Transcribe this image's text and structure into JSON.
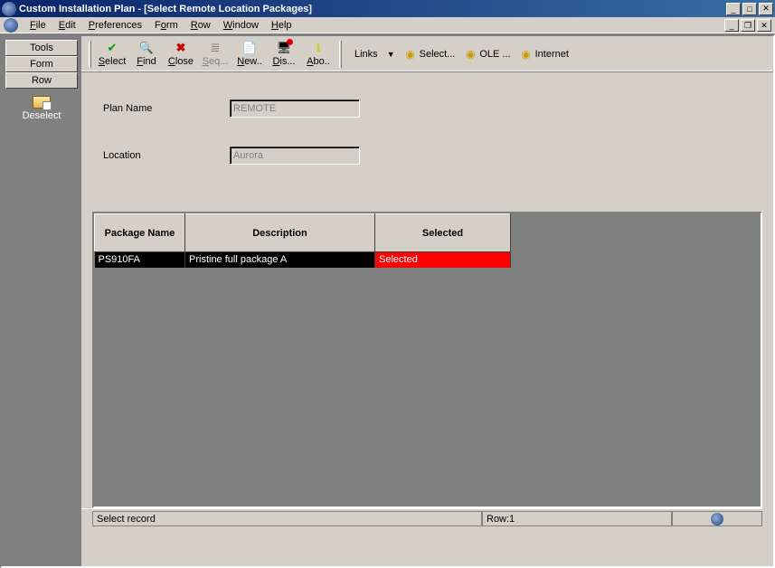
{
  "window": {
    "title": "Custom Installation Plan - [Select Remote Location Packages]"
  },
  "menubar": {
    "file": "File",
    "edit": "Edit",
    "preferences": "Preferences",
    "form": "Form",
    "row": "Row",
    "window": "Window",
    "help": "Help"
  },
  "sidepanel": {
    "tabs": {
      "tools": "Tools",
      "form": "Form",
      "row": "Row"
    },
    "action": "Deselect"
  },
  "toolbar": {
    "select": "Select",
    "find": "Find",
    "close": "Close",
    "seq": "Seq...",
    "new": "New..",
    "dis": "Dis...",
    "abo": "Abo..",
    "links_label": "Links",
    "link_select": "Select...",
    "link_ole": "OLE ...",
    "link_internet": "Internet"
  },
  "form": {
    "plan_name_label": "Plan Name",
    "plan_name_value": "REMOTE",
    "location_label": "Location",
    "location_value": "Aurora"
  },
  "grid": {
    "headers": {
      "package_name": "Package Name",
      "description": "Description",
      "selected": "Selected"
    },
    "rows": [
      {
        "package_name": "PS910FA",
        "description": "Pristine full package A",
        "selected": "Selected"
      }
    ]
  },
  "statusbar": {
    "msg": "Select record",
    "row": "Row:1"
  }
}
